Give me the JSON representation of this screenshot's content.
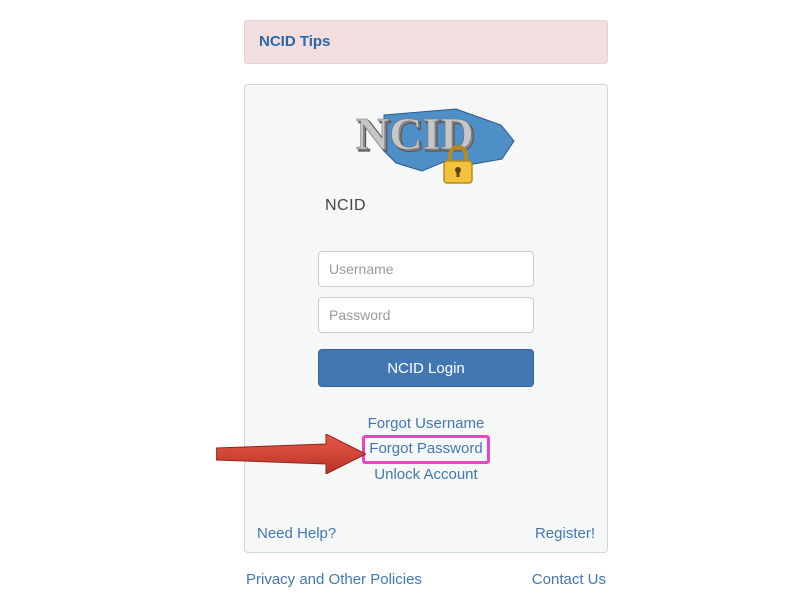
{
  "tips": {
    "label": "NCID Tips"
  },
  "logo": {
    "title": "NCID",
    "subtitle": "NCID"
  },
  "form": {
    "username_placeholder": "Username",
    "password_placeholder": "Password",
    "login_button": "NCID Login"
  },
  "links": {
    "forgot_username": "Forgot Username",
    "forgot_password": "Forgot Password",
    "unlock_account": "Unlock Account",
    "need_help": "Need Help?",
    "register": "Register!"
  },
  "footer": {
    "privacy": "Privacy and Other Policies",
    "contact": "Contact Us"
  }
}
